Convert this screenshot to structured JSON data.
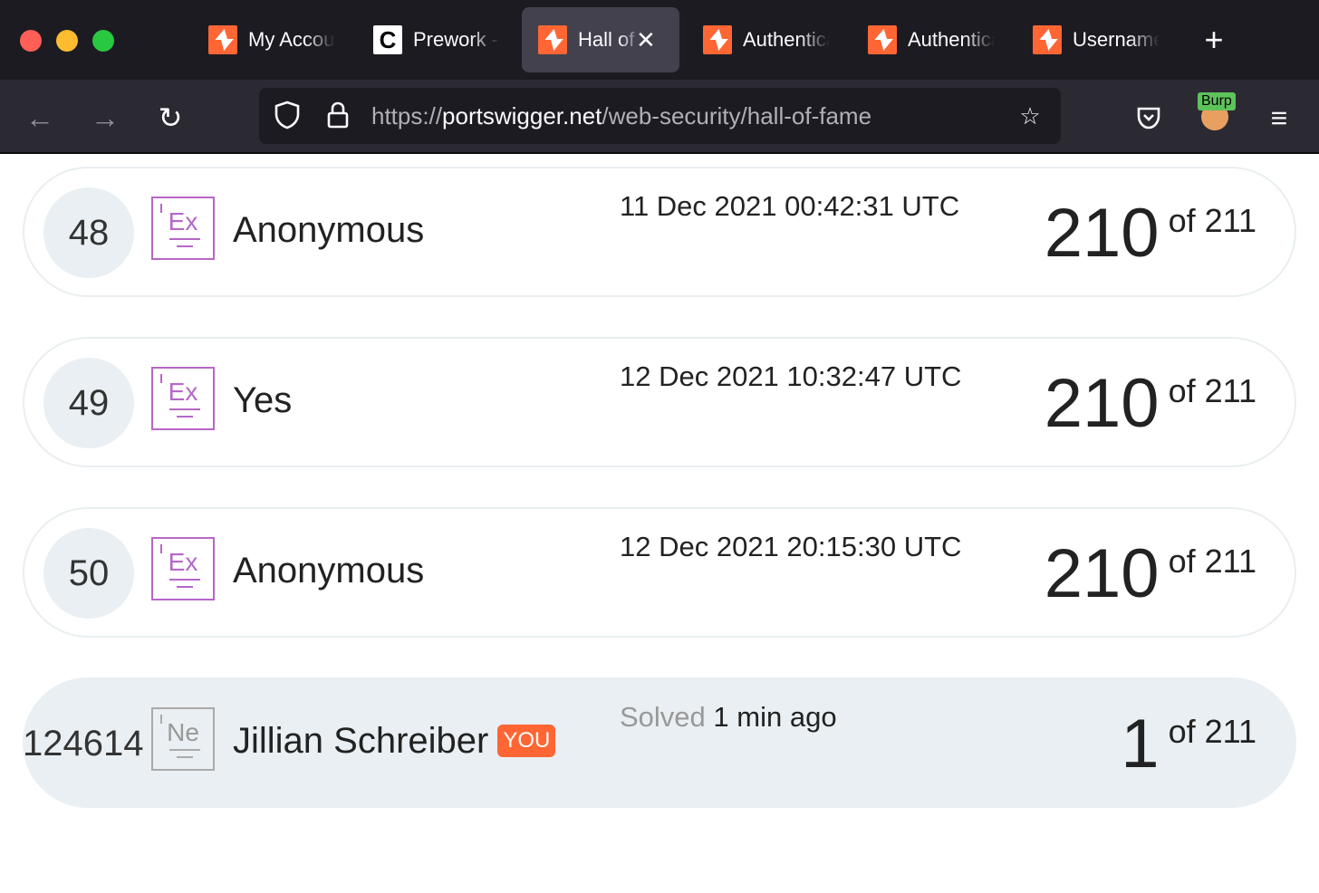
{
  "browser": {
    "tabs": [
      {
        "label": "My Account",
        "icon": "portswigger-icon",
        "active": false
      },
      {
        "label": "Prework - C",
        "icon": "codepath-icon",
        "active": false
      },
      {
        "label": "Hall of Fame",
        "icon": "portswigger-icon",
        "active": true
      },
      {
        "label": "Authentication",
        "icon": "portswigger-icon",
        "active": false
      },
      {
        "label": "Authentication",
        "icon": "portswigger-icon",
        "active": false
      },
      {
        "label": "Username",
        "icon": "portswigger-icon",
        "active": false
      }
    ],
    "url_scheme": "https://",
    "url_host": "portswigger.net",
    "url_path": "/web-security/hall-of-fame",
    "extension_badge": "Burp"
  },
  "leaderboard": {
    "rows": [
      {
        "rank": "48",
        "level": "Ex",
        "name": "Anonymous",
        "date": "11 Dec 2021 00:42:31 UTC",
        "solved": "210",
        "total": "of 211"
      },
      {
        "rank": "49",
        "level": "Ex",
        "name": "Yes",
        "date": "12 Dec 2021 10:32:47 UTC",
        "solved": "210",
        "total": "of 211"
      },
      {
        "rank": "50",
        "level": "Ex",
        "name": "Anonymous",
        "date": "12 Dec 2021 20:15:30 UTC",
        "solved": "210",
        "total": "of 211"
      }
    ],
    "you": {
      "rank": "124614",
      "level": "Ne",
      "name": "Jillian Schreiber",
      "badge": "YOU",
      "solved_label": "Solved",
      "solved_when": "1 min ago",
      "solved": "1",
      "total": "of 211"
    }
  },
  "colors": {
    "accent": "#ff6633",
    "expert": "#b667c8",
    "row_highlight": "#e9eff2"
  }
}
